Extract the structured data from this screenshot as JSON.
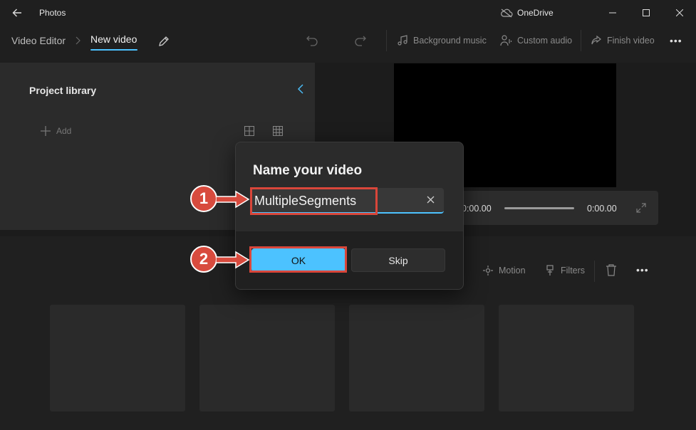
{
  "titlebar": {
    "app_name": "Photos",
    "onedrive_label": "OneDrive"
  },
  "toolbar": {
    "crumb_parent": "Video Editor",
    "crumb_current": "New video",
    "background_music": "Background music",
    "custom_audio": "Custom audio",
    "finish_video": "Finish video",
    "more": "•••"
  },
  "library": {
    "title": "Project library",
    "add_label": "Add"
  },
  "playback": {
    "current_time": "0:00.00",
    "end_time": "0:00.00"
  },
  "storyboard_tools": {
    "motion": "Motion",
    "filters": "Filters",
    "more": "•••"
  },
  "dialog": {
    "title": "Name your video",
    "input_value": "MultipleSegments",
    "ok_label": "OK",
    "skip_label": "Skip"
  },
  "annotations": {
    "step1": "1",
    "step2": "2"
  },
  "colors": {
    "accent": "#4cc2ff",
    "highlight": "#d9463a",
    "badge": "#d84b3e"
  }
}
